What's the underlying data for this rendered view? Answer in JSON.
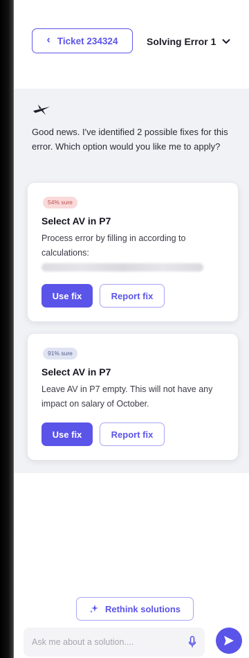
{
  "header": {
    "ticket_label": "Ticket 234324",
    "solving_label": "Solving Error 1"
  },
  "chat": {
    "intro": "Good news. I've identified 2 possible fixes for this error. Which option would you like me to apply?",
    "cards": [
      {
        "confidence": "54% sure",
        "title": "Select AV in P7",
        "text": "Process error by filling in according to calculations:",
        "use_fix_label": "Use fix",
        "report_fix_label": "Report fix"
      },
      {
        "confidence": "91% sure",
        "title": "Select AV in P7",
        "text": "Leave AV in P7 empty. This will not have any impact on salary of October.",
        "use_fix_label": "Use fix",
        "report_fix_label": "Report fix"
      }
    ]
  },
  "footer": {
    "rethink_label": "Rethink solutions",
    "input_placeholder": "Ask me about a solution....",
    "input_value": ""
  },
  "colors": {
    "accent": "#5b54e8",
    "badge_low": "#f9d9d9",
    "badge_high": "#dfe3f3"
  },
  "icons": {
    "back": "chevron-left-icon",
    "dropdown": "chevron-down-icon",
    "assistant": "plane-icon",
    "rethink": "sparkle-icon",
    "mic": "microphone-icon",
    "send": "send-icon"
  }
}
